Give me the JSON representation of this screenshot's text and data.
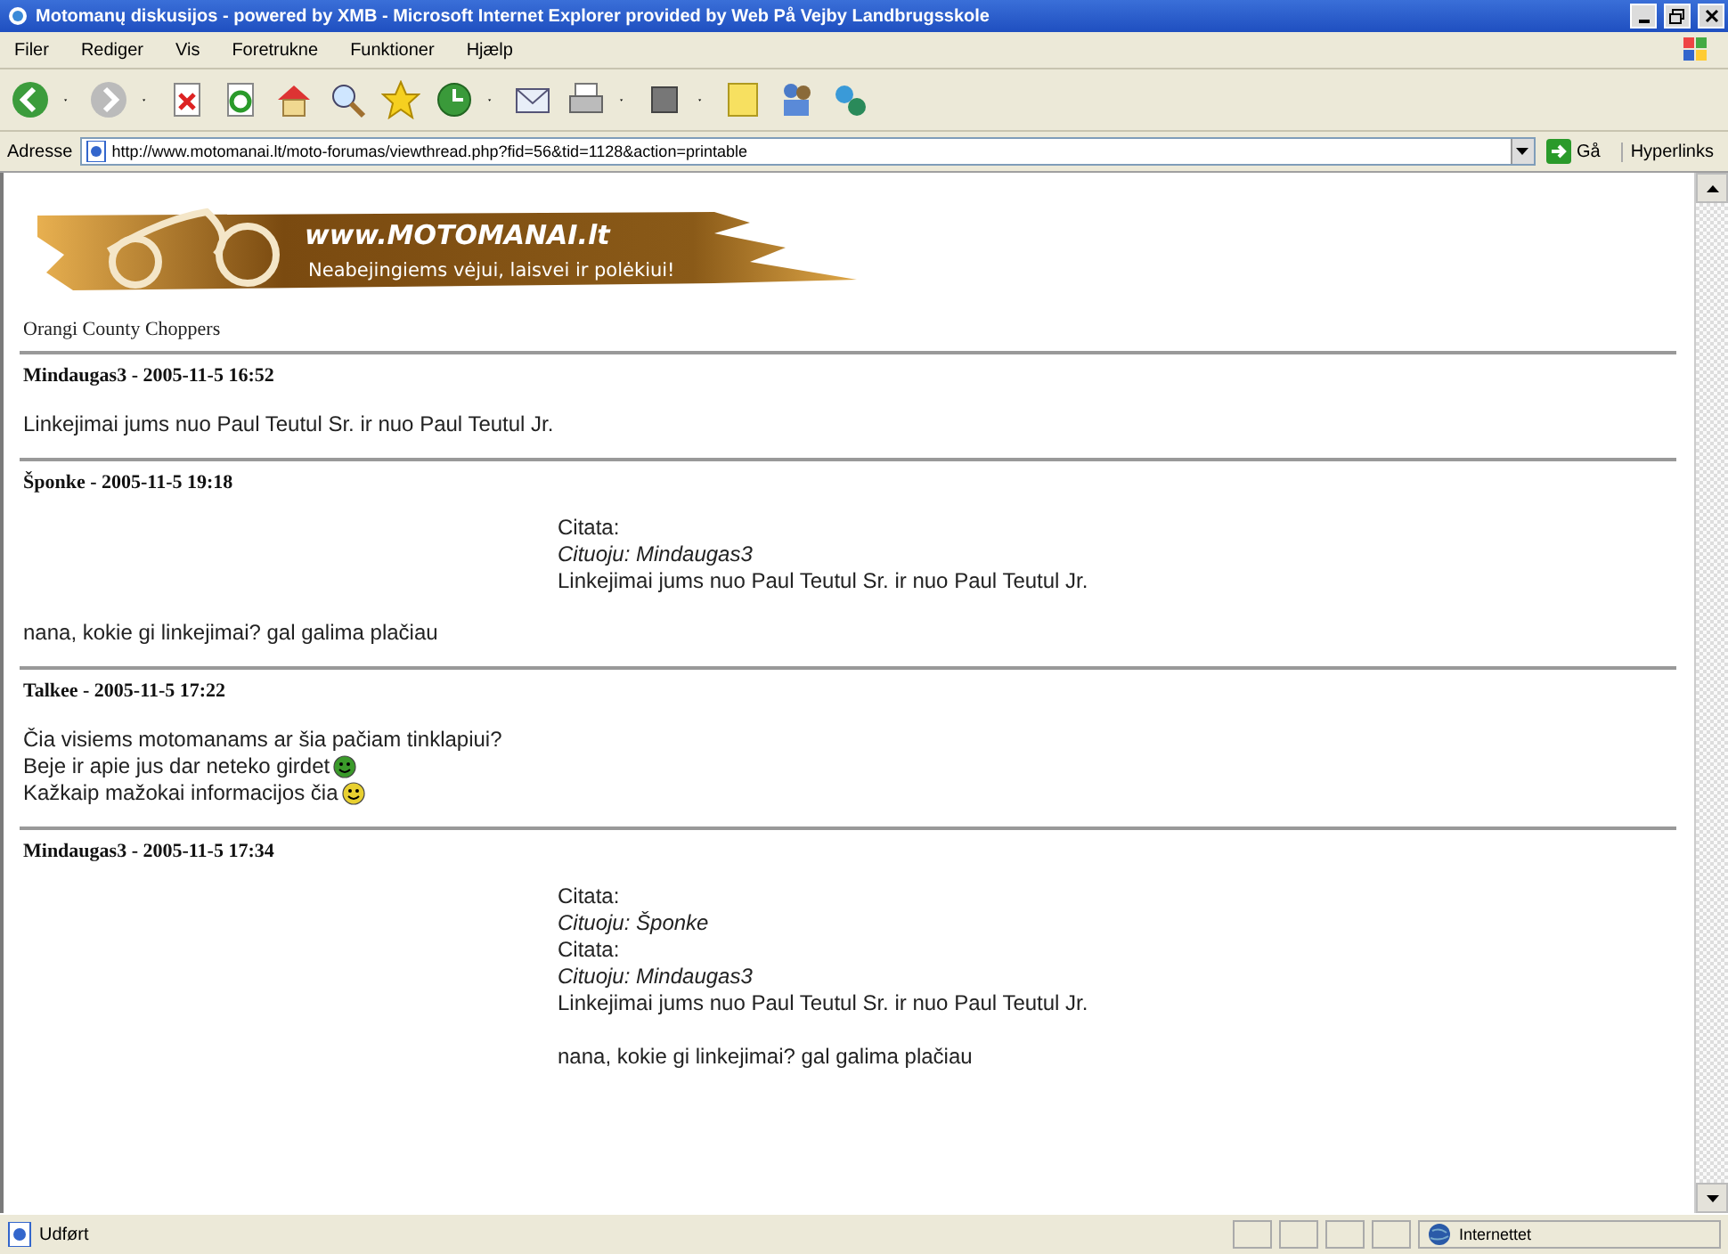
{
  "window": {
    "title": "Motomanų diskusijos - powered by XMB - Microsoft Internet Explorer provided by Web På Vejby Landbrugsskole"
  },
  "menu": [
    "Filer",
    "Rediger",
    "Vis",
    "Foretrukne",
    "Funktioner",
    "Hjælp"
  ],
  "address_bar": {
    "label": "Adresse",
    "value": "http://www.motomanai.lt/moto-forumas/viewthread.php?fid=56&tid=1128&action=printable",
    "go": "Gå",
    "links": "Hyperlinks"
  },
  "banner": {
    "site": "www.MOTOMANAI.lt",
    "slogan": "Neabejingiems vėjui, laisvei ir polėkiui!"
  },
  "thread_title": "Orangi County Choppers",
  "posts": [
    {
      "header": "Mindaugas3 - 2005-11-5 16:52",
      "lines": [
        {
          "text": "Linkejimai jums nuo Paul Teutul Sr. ir nuo Paul Teutul Jr."
        }
      ]
    },
    {
      "header": "Šponke - 2005-11-5 19:18",
      "quote": [
        {
          "kind": "label",
          "text": "Citata:"
        },
        {
          "kind": "attribution",
          "text": "Cituoju: Mindaugas3"
        },
        {
          "kind": "text",
          "text": "Linkejimai jums nuo Paul Teutul Sr. ir nuo Paul Teutul Jr."
        }
      ],
      "lines": [
        {
          "text": "nana, kokie gi linkejimai? gal galima plačiau"
        }
      ]
    },
    {
      "header": "Talkee - 2005-11-5 17:22",
      "lines": [
        {
          "text": "Čia visiems motomanams ar šia pačiam tinklapiui?"
        },
        {
          "text": "Beje ir apie jus dar neteko girdet",
          "emoticon": {
            "color": "#3a9a2a"
          }
        },
        {
          "text": "Kažkaip mažokai informacijos čia",
          "emoticon": {
            "color": "#e8d030"
          }
        }
      ]
    },
    {
      "header": "Mindaugas3 - 2005-11-5 17:34",
      "quote": [
        {
          "kind": "label",
          "text": "Citata:"
        },
        {
          "kind": "attribution",
          "text": "Cituoju: Šponke"
        },
        {
          "kind": "label",
          "text": "Citata:"
        },
        {
          "kind": "attribution",
          "text": "Cituoju: Mindaugas3"
        },
        {
          "kind": "text",
          "text": "Linkejimai jums nuo Paul Teutul Sr. ir nuo Paul Teutul Jr."
        },
        {
          "kind": "gap"
        },
        {
          "kind": "text",
          "text": "nana, kokie gi linkejimai? gal galima plačiau"
        }
      ]
    }
  ],
  "status_bar": {
    "text": "Udført",
    "zone": "Internettet"
  }
}
